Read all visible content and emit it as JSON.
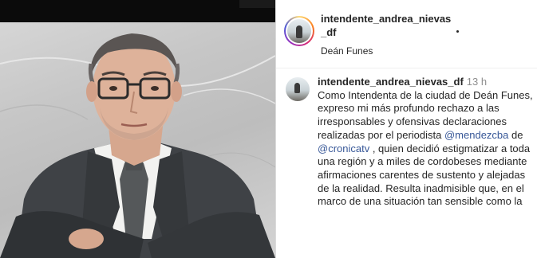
{
  "post": {
    "username_line1": "intendente_andrea_nievas",
    "username_line2": "_df",
    "location": "Deán Funes"
  },
  "comment": {
    "username": "intendente_andrea_nievas_df",
    "time": "13 h",
    "text_1": "Como Intendenta de la ciudad de Deán Funes, expreso mi más profundo rechazo a las irresponsables y ofensivas declaraciones realizadas por el periodista ",
    "mention_1": "@mendezcba",
    "text_2": " de ",
    "mention_2": "@cronicatv",
    "text_3": " , quien decidió estigmatizar a toda una región y a miles de cordobeses mediante afirmaciones carentes de sustento y alejadas de la realidad. Resulta inadmisible que, en el marco de una situación tan sensible como la"
  },
  "colors": {
    "mention": "#385898",
    "time": "#8e8e8e",
    "text": "#262626"
  }
}
